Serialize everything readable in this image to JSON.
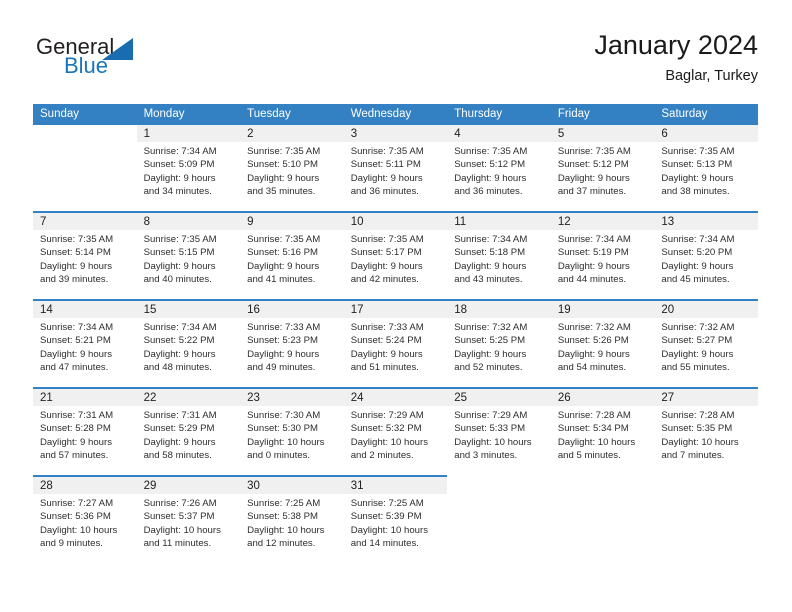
{
  "brand": {
    "name_part1": "General",
    "name_part2": "Blue",
    "triangle_color": "#1a6cb0"
  },
  "header": {
    "title": "January 2024",
    "location": "Baglar, Turkey"
  },
  "theme": {
    "header_blue": "#3380c2",
    "daynum_band": "#f0f0f0",
    "brand_blue": "#1a75bc",
    "text": "#2e2e2e"
  },
  "weekdays": [
    "Sunday",
    "Monday",
    "Tuesday",
    "Wednesday",
    "Thursday",
    "Friday",
    "Saturday"
  ],
  "weeks": [
    [
      {
        "day": ""
      },
      {
        "day": "1",
        "sunrise": "Sunrise: 7:34 AM",
        "sunset": "Sunset: 5:09 PM",
        "daylight_1": "Daylight: 9 hours",
        "daylight_2": "and 34 minutes."
      },
      {
        "day": "2",
        "sunrise": "Sunrise: 7:35 AM",
        "sunset": "Sunset: 5:10 PM",
        "daylight_1": "Daylight: 9 hours",
        "daylight_2": "and 35 minutes."
      },
      {
        "day": "3",
        "sunrise": "Sunrise: 7:35 AM",
        "sunset": "Sunset: 5:11 PM",
        "daylight_1": "Daylight: 9 hours",
        "daylight_2": "and 36 minutes."
      },
      {
        "day": "4",
        "sunrise": "Sunrise: 7:35 AM",
        "sunset": "Sunset: 5:12 PM",
        "daylight_1": "Daylight: 9 hours",
        "daylight_2": "and 36 minutes."
      },
      {
        "day": "5",
        "sunrise": "Sunrise: 7:35 AM",
        "sunset": "Sunset: 5:12 PM",
        "daylight_1": "Daylight: 9 hours",
        "daylight_2": "and 37 minutes."
      },
      {
        "day": "6",
        "sunrise": "Sunrise: 7:35 AM",
        "sunset": "Sunset: 5:13 PM",
        "daylight_1": "Daylight: 9 hours",
        "daylight_2": "and 38 minutes."
      }
    ],
    [
      {
        "day": "7",
        "sunrise": "Sunrise: 7:35 AM",
        "sunset": "Sunset: 5:14 PM",
        "daylight_1": "Daylight: 9 hours",
        "daylight_2": "and 39 minutes."
      },
      {
        "day": "8",
        "sunrise": "Sunrise: 7:35 AM",
        "sunset": "Sunset: 5:15 PM",
        "daylight_1": "Daylight: 9 hours",
        "daylight_2": "and 40 minutes."
      },
      {
        "day": "9",
        "sunrise": "Sunrise: 7:35 AM",
        "sunset": "Sunset: 5:16 PM",
        "daylight_1": "Daylight: 9 hours",
        "daylight_2": "and 41 minutes."
      },
      {
        "day": "10",
        "sunrise": "Sunrise: 7:35 AM",
        "sunset": "Sunset: 5:17 PM",
        "daylight_1": "Daylight: 9 hours",
        "daylight_2": "and 42 minutes."
      },
      {
        "day": "11",
        "sunrise": "Sunrise: 7:34 AM",
        "sunset": "Sunset: 5:18 PM",
        "daylight_1": "Daylight: 9 hours",
        "daylight_2": "and 43 minutes."
      },
      {
        "day": "12",
        "sunrise": "Sunrise: 7:34 AM",
        "sunset": "Sunset: 5:19 PM",
        "daylight_1": "Daylight: 9 hours",
        "daylight_2": "and 44 minutes."
      },
      {
        "day": "13",
        "sunrise": "Sunrise: 7:34 AM",
        "sunset": "Sunset: 5:20 PM",
        "daylight_1": "Daylight: 9 hours",
        "daylight_2": "and 45 minutes."
      }
    ],
    [
      {
        "day": "14",
        "sunrise": "Sunrise: 7:34 AM",
        "sunset": "Sunset: 5:21 PM",
        "daylight_1": "Daylight: 9 hours",
        "daylight_2": "and 47 minutes."
      },
      {
        "day": "15",
        "sunrise": "Sunrise: 7:34 AM",
        "sunset": "Sunset: 5:22 PM",
        "daylight_1": "Daylight: 9 hours",
        "daylight_2": "and 48 minutes."
      },
      {
        "day": "16",
        "sunrise": "Sunrise: 7:33 AM",
        "sunset": "Sunset: 5:23 PM",
        "daylight_1": "Daylight: 9 hours",
        "daylight_2": "and 49 minutes."
      },
      {
        "day": "17",
        "sunrise": "Sunrise: 7:33 AM",
        "sunset": "Sunset: 5:24 PM",
        "daylight_1": "Daylight: 9 hours",
        "daylight_2": "and 51 minutes."
      },
      {
        "day": "18",
        "sunrise": "Sunrise: 7:32 AM",
        "sunset": "Sunset: 5:25 PM",
        "daylight_1": "Daylight: 9 hours",
        "daylight_2": "and 52 minutes."
      },
      {
        "day": "19",
        "sunrise": "Sunrise: 7:32 AM",
        "sunset": "Sunset: 5:26 PM",
        "daylight_1": "Daylight: 9 hours",
        "daylight_2": "and 54 minutes."
      },
      {
        "day": "20",
        "sunrise": "Sunrise: 7:32 AM",
        "sunset": "Sunset: 5:27 PM",
        "daylight_1": "Daylight: 9 hours",
        "daylight_2": "and 55 minutes."
      }
    ],
    [
      {
        "day": "21",
        "sunrise": "Sunrise: 7:31 AM",
        "sunset": "Sunset: 5:28 PM",
        "daylight_1": "Daylight: 9 hours",
        "daylight_2": "and 57 minutes."
      },
      {
        "day": "22",
        "sunrise": "Sunrise: 7:31 AM",
        "sunset": "Sunset: 5:29 PM",
        "daylight_1": "Daylight: 9 hours",
        "daylight_2": "and 58 minutes."
      },
      {
        "day": "23",
        "sunrise": "Sunrise: 7:30 AM",
        "sunset": "Sunset: 5:30 PM",
        "daylight_1": "Daylight: 10 hours",
        "daylight_2": "and 0 minutes."
      },
      {
        "day": "24",
        "sunrise": "Sunrise: 7:29 AM",
        "sunset": "Sunset: 5:32 PM",
        "daylight_1": "Daylight: 10 hours",
        "daylight_2": "and 2 minutes."
      },
      {
        "day": "25",
        "sunrise": "Sunrise: 7:29 AM",
        "sunset": "Sunset: 5:33 PM",
        "daylight_1": "Daylight: 10 hours",
        "daylight_2": "and 3 minutes."
      },
      {
        "day": "26",
        "sunrise": "Sunrise: 7:28 AM",
        "sunset": "Sunset: 5:34 PM",
        "daylight_1": "Daylight: 10 hours",
        "daylight_2": "and 5 minutes."
      },
      {
        "day": "27",
        "sunrise": "Sunrise: 7:28 AM",
        "sunset": "Sunset: 5:35 PM",
        "daylight_1": "Daylight: 10 hours",
        "daylight_2": "and 7 minutes."
      }
    ],
    [
      {
        "day": "28",
        "sunrise": "Sunrise: 7:27 AM",
        "sunset": "Sunset: 5:36 PM",
        "daylight_1": "Daylight: 10 hours",
        "daylight_2": "and 9 minutes."
      },
      {
        "day": "29",
        "sunrise": "Sunrise: 7:26 AM",
        "sunset": "Sunset: 5:37 PM",
        "daylight_1": "Daylight: 10 hours",
        "daylight_2": "and 11 minutes."
      },
      {
        "day": "30",
        "sunrise": "Sunrise: 7:25 AM",
        "sunset": "Sunset: 5:38 PM",
        "daylight_1": "Daylight: 10 hours",
        "daylight_2": "and 12 minutes."
      },
      {
        "day": "31",
        "sunrise": "Sunrise: 7:25 AM",
        "sunset": "Sunset: 5:39 PM",
        "daylight_1": "Daylight: 10 hours",
        "daylight_2": "and 14 minutes."
      },
      {
        "day": ""
      },
      {
        "day": ""
      },
      {
        "day": ""
      }
    ]
  ]
}
